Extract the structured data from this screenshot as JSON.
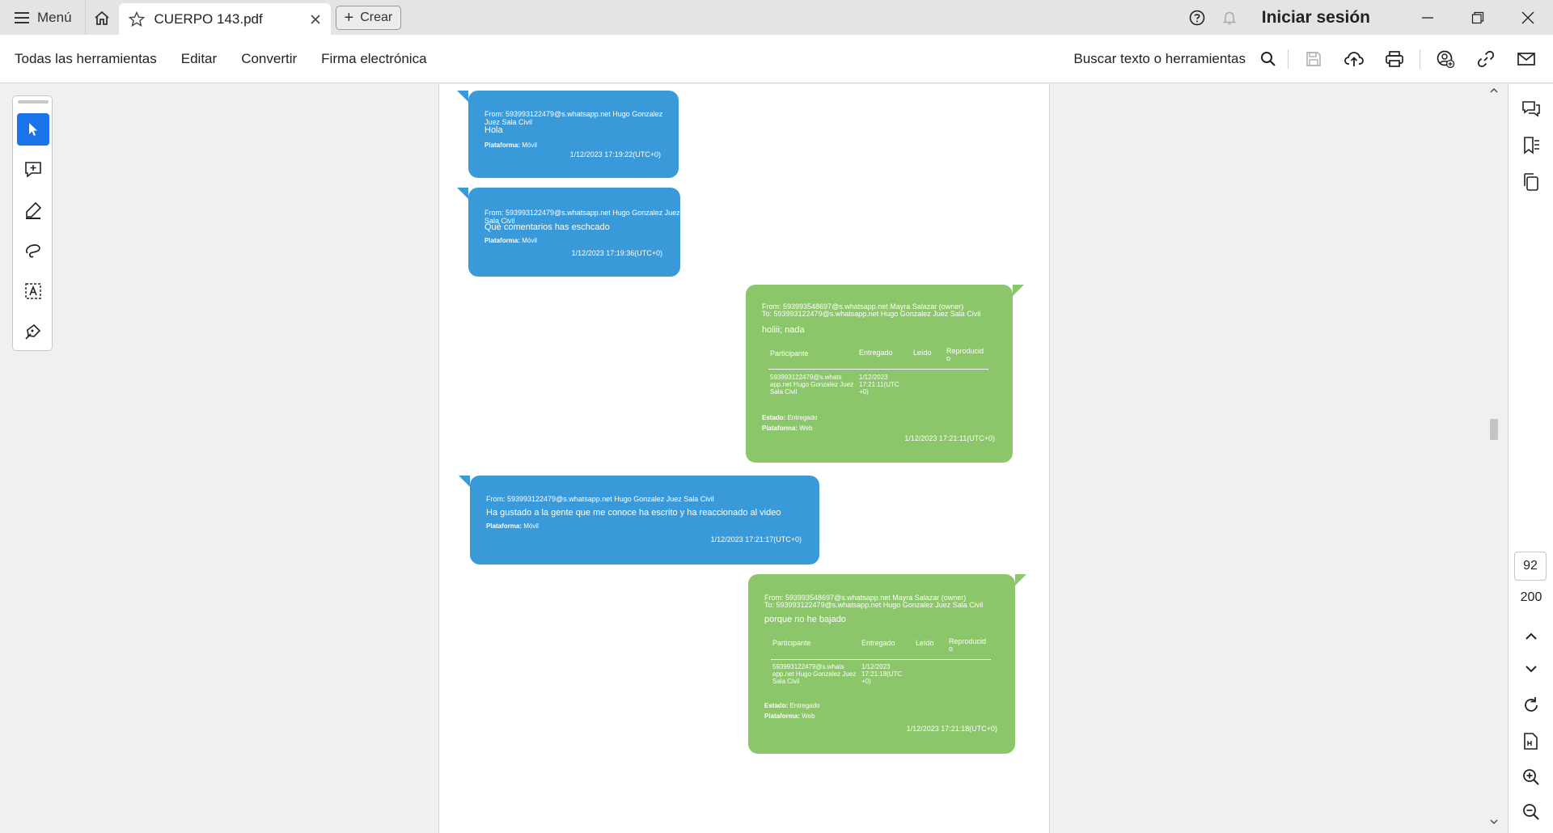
{
  "titlebar": {
    "menu_label": "Menú",
    "tab_title": "CUERPO 143.pdf",
    "create_label": "Crear",
    "signin_label": "Iniciar sesión"
  },
  "toolbar": {
    "menus": [
      "Todas las herramientas",
      "Editar",
      "Convertir",
      "Firma electrónica"
    ],
    "search_label": "Buscar texto o herramientas"
  },
  "pagination": {
    "current_page": "92",
    "total_pages": "200"
  },
  "messages": [
    {
      "side": "incoming",
      "from": "From: 593993122479@s.whatsapp.net Hugo Gonzalez Juez Sala Civil",
      "text": "Hola",
      "platform_label": "Plataforma:",
      "platform": "Móvil",
      "timestamp": "1/12/2023 17:19:22(UTC+0)"
    },
    {
      "side": "incoming",
      "from": "From: 593993122479@s.whatsapp.net Hugo Gonzalez Juez Sala Civil",
      "text": "Qué comentarios has eschcado",
      "platform_label": "Plataforma:",
      "platform": "Móvil",
      "timestamp": "1/12/2023 17:19:36(UTC+0)"
    },
    {
      "side": "outgoing",
      "from": "From: 593993548697@s.whatsapp.net Mayra Salazar (owner)",
      "to": "To: 593993122479@s.whatsapp.net Hugo Gonzalez Juez Sala Civil",
      "text": "holiii; nada",
      "table_headers": [
        "Participante",
        "Entregado",
        "Leído",
        "Reproducid o"
      ],
      "table_row": [
        "593993122479@s.whats app.net Hugo Gonzalez Juez Sala Civil",
        "1/12/2023 17:21:11(UTC +0)"
      ],
      "estado_label": "Estado:",
      "estado": "Entregado",
      "platform_label": "Plataforma:",
      "platform": "Web",
      "timestamp": "1/12/2023 17:21:11(UTC+0)"
    },
    {
      "side": "incoming",
      "from": "From: 593993122479@s.whatsapp.net Hugo Gonzalez Juez Sala Civil",
      "text": "Ha gustado a   la gente que me conoce ha escrito y ha reaccionado al video",
      "platform_label": "Plataforma:",
      "platform": "Móvil",
      "timestamp": "1/12/2023 17:21:17(UTC+0)"
    },
    {
      "side": "outgoing",
      "from": "From: 593993548697@s.whatsapp.net Mayra Salazar (owner)",
      "to": "To: 593993122479@s.whatsapp.net Hugo Gonzalez Juez Sala Civil",
      "text": "porque no he bajado",
      "table_headers": [
        "Participante",
        "Entregado",
        "Leído",
        "Reproducid o"
      ],
      "table_row": [
        "593993122479@s.whats app.net Hugo Gonzalez Juez Sala Civil",
        "1/12/2023 17:21:18(UTC +0)"
      ],
      "estado_label": "Estado:",
      "estado": "Entregado",
      "platform_label": "Plataforma:",
      "platform": "Web",
      "timestamp": "1/12/2023 17:21:18(UTC+0)"
    }
  ],
  "colors": {
    "incoming_bubble": "#3a9ad9",
    "outgoing_bubble": "#8cc66a",
    "accent": "#1a73e8"
  }
}
